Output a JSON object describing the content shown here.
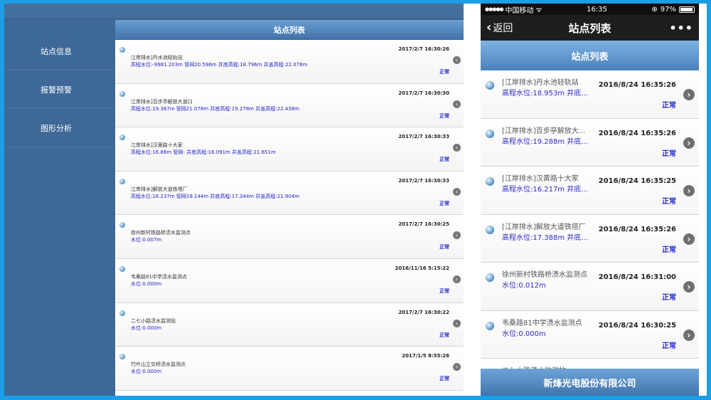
{
  "tablet": {
    "sidebar": {
      "items": [
        {
          "label": "站点信息"
        },
        {
          "label": "报警预警"
        },
        {
          "label": "图形分析"
        }
      ]
    },
    "list_title": "站点列表",
    "rows": [
      {
        "name": "江岸排水]丹水池轻轨站",
        "detail": "高程水位:-9981.203m 管网20.596m 井底高程:18.796m 井盖高程:22.078m",
        "time": "2017/2/7 16:30:26",
        "status": "正常"
      },
      {
        "name": "江岸排水]百步亭解放大道口",
        "detail": "高程水位:19.367m 管网21.078m 井底高程:19.278m 井盖高程:22.438m",
        "time": "2017/2/7 16:30:30",
        "status": "正常"
      },
      {
        "name": "江岸排水]汉黄路十大家",
        "detail": "高程水位:16.86m 管网- 井底高程:16.091m 井盖高程:21.651m",
        "time": "2017/2/7 16:30:33",
        "status": "正常"
      },
      {
        "name": "江岸排水]解放大道铁塔厂",
        "detail": "高程水位:18.237m 管网19.144m 井底高程:17.344m 井盖高程:21.904m",
        "time": "2017/2/7 16:30:33",
        "status": "正常"
      },
      {
        "name": "徐州新村铁路桥渍水监测点",
        "detail": "水位:0.007m",
        "time": "2017/2/7 16:30:25",
        "status": "正常"
      },
      {
        "name": "韦桑路81中学渍水监测点",
        "detail": "水位:0.000m",
        "time": "2016/11/16 5:15:22",
        "status": "正常"
      },
      {
        "name": "二七小路渍水监测站",
        "detail": "水位:0.000m",
        "time": "2017/2/7 16:30:22",
        "status": "正常"
      },
      {
        "name": "竹叶山立交桥渍水监测点",
        "detail": "水位:0.000m",
        "time": "2017/1/5 8:55:26",
        "status": "正常"
      }
    ]
  },
  "phone": {
    "statusbar": {
      "carrier": "中国移动",
      "wifi": "ᯤ",
      "time": "16:35",
      "battery": "97%"
    },
    "nav": {
      "back_label": "返回",
      "title": "站点列表",
      "more": "•••"
    },
    "list_title": "站点列表",
    "rows": [
      {
        "name": "[江岸排水]丹水池轻轨站",
        "detail": "高程水位:18.953m 井底...",
        "time": "2016/8/24 16:35:26",
        "status": "正常"
      },
      {
        "name": "[江岸排水]百步亭解放大...",
        "detail": "高程水位:19.288m 井底...",
        "time": "2016/8/24 16:35:26",
        "status": "正常"
      },
      {
        "name": "[江岸排水]汉黄路十大家",
        "detail": "高程水位:16.217m 井底...",
        "time": "2016/8/24 16:35:25",
        "status": "正常"
      },
      {
        "name": "[江岸排水]解放大道铁塔厂",
        "detail": "高程水位:17.388m 井底...",
        "time": "2016/8/24 16:35:26",
        "status": "正常"
      },
      {
        "name": "徐州新村铁路桥渍水监测点",
        "detail": "水位:0.012m",
        "time": "2016/8/24 16:31:00",
        "status": "正常"
      },
      {
        "name": "韦桑路81中学渍水监测点",
        "detail": "水位:0.000m",
        "time": "2016/8/24 16:30:25",
        "status": "正常"
      },
      {
        "name": "二七小路渍水监测站",
        "detail": "",
        "time": "",
        "status": ""
      }
    ],
    "footer": "新烽光电股份有限公司"
  },
  "icons": {
    "station": "station-dot-icon",
    "arrow": "chevron-right-icon",
    "back": "chevron-left-icon",
    "more": "more-icon"
  },
  "colors": {
    "page_bg": "#1b9ee6",
    "sidebar_bg": "#3e6897",
    "header_gradient_top": "#6c9fd0",
    "header_gradient_bottom": "#3f73aa",
    "detail_text": "#2222cc"
  }
}
